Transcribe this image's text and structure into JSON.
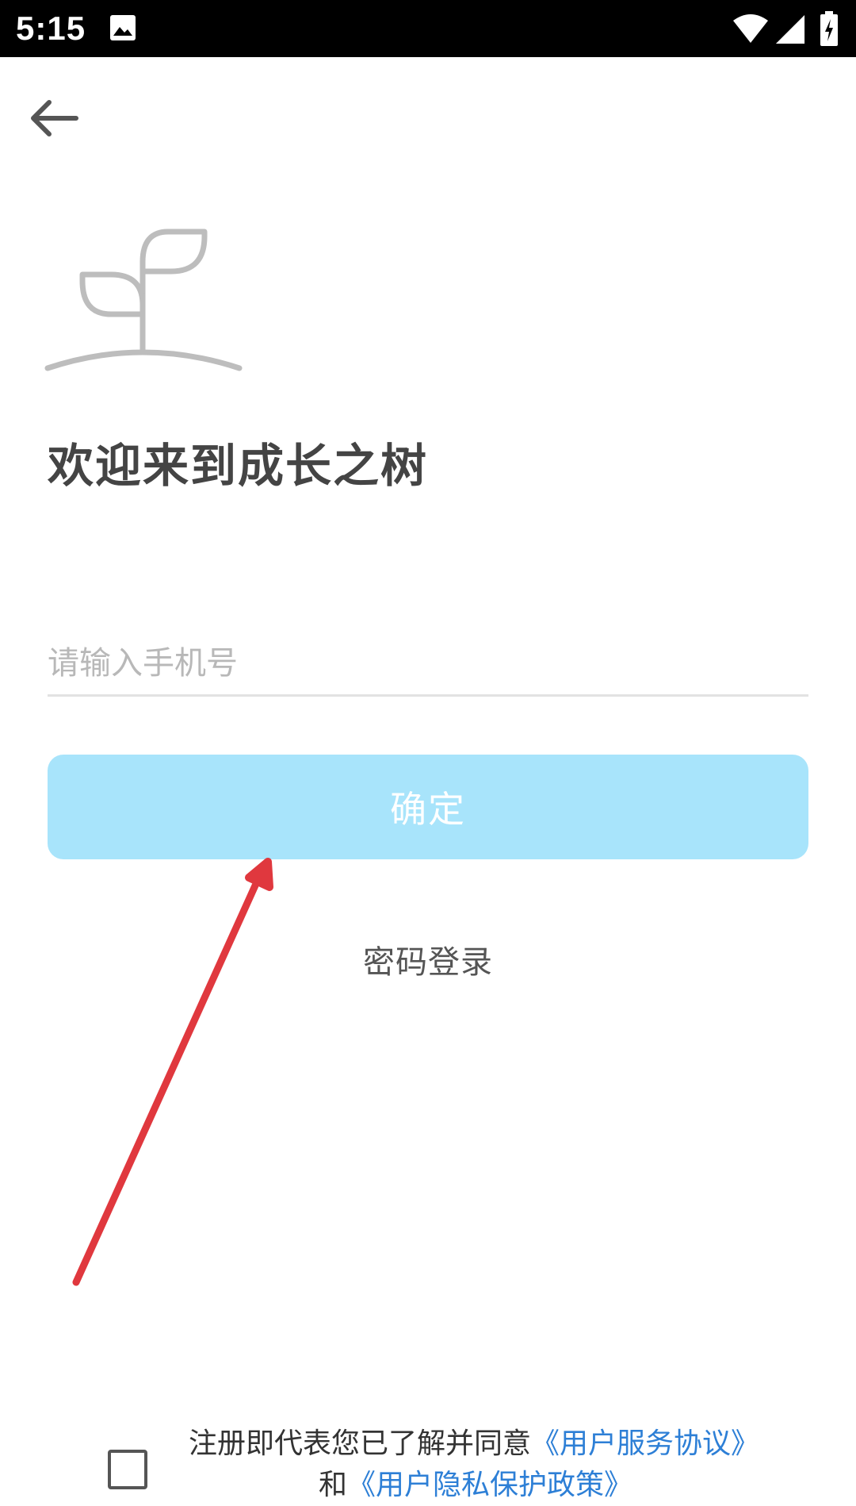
{
  "status_bar": {
    "time": "5:15",
    "icons": [
      "image-icon",
      "wifi-icon",
      "signal-icon",
      "battery-charging-icon"
    ]
  },
  "header": {
    "back_icon": "arrow-left-icon"
  },
  "logo": {
    "icon": "sprout-icon"
  },
  "welcome": {
    "title": "欢迎来到成长之树"
  },
  "login_form": {
    "phone_placeholder": "请输入手机号",
    "phone_value": "",
    "confirm_label": "确定",
    "password_login_label": "密码登录"
  },
  "agreement": {
    "prefix": "注册即代表您已了解并同意",
    "terms_link": "《用户服务协议》",
    "conjunction": "和",
    "privacy_link": "《用户隐私保护政策》",
    "checked": false
  },
  "colors": {
    "accent_light": "#a8e4fb",
    "link": "#2d7fd6",
    "annotation_arrow": "#e0383e"
  }
}
